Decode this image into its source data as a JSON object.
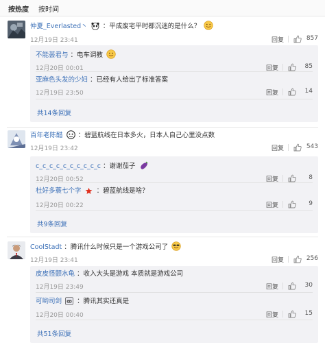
{
  "sort": {
    "hot": "按热度",
    "time": "按时间"
  },
  "like_color": "#888888",
  "link_color": "#3a6fb7",
  "comments": [
    {
      "user": "仲夏_Everlasted丶",
      "user_icon": "panda-icon",
      "text": "：平成废宅平时都沉迷的是什么？",
      "emoji": "cute-face-emoji",
      "time": "12月19日 23:41",
      "reply": "回复",
      "likes": "857",
      "replies": [
        {
          "user": "不能荟君与",
          "text": "：电车调教",
          "emoji": "laughing-emoji",
          "time": "12月20日 00:01",
          "reply": "回复",
          "likes": "85"
        },
        {
          "user": "亚麻色头发的少妇",
          "text": "：已经有人给出了标准答案",
          "time": "12月19日 23:50",
          "reply": "回复",
          "likes": "14"
        }
      ],
      "more": "共14条回复"
    },
    {
      "user": "百年老陈醋",
      "user_icon": "monkey-face-icon",
      "text": "：碧蓝航线在日本多火，日本人自己心里没点数",
      "time": "12月19日 23:42",
      "reply": "回复",
      "likes": "543",
      "replies": [
        {
          "user": "c_c_c_c_c_c_c_c_c_c",
          "text": "：谢谢茄子",
          "emoji": "eggplant-emoji",
          "time": "12月20日 00:52",
          "reply": "回复",
          "likes": "8"
        },
        {
          "user": "杜好多蓑七个字",
          "user_icon": "star-badge-icon",
          "text": "：碧蓝航线是啥？",
          "time": "12月20日 00:22",
          "reply": "回复",
          "likes": "9"
        }
      ],
      "more": "共9条回复"
    },
    {
      "user": "CoolStadt",
      "text": "：腾讯什么时候只是一个游戏公司了",
      "emoji": "cool-face-emoji",
      "time": "12月19日 23:41",
      "reply": "回复",
      "likes": "256",
      "replies": [
        {
          "user": "皮皮怪颤水龟",
          "text": "：收入大头是游戏 本质就是游戏公司",
          "time": "12月19日 23:49",
          "reply": "回复",
          "likes": "30"
        },
        {
          "user": "可哟司剑",
          "user_icon": "game-badge-icon",
          "text": "：腾讯其实还真是",
          "time": "12月20日 00:40",
          "reply": "回复",
          "likes": "15"
        }
      ],
      "more": "共51条回复"
    }
  ]
}
